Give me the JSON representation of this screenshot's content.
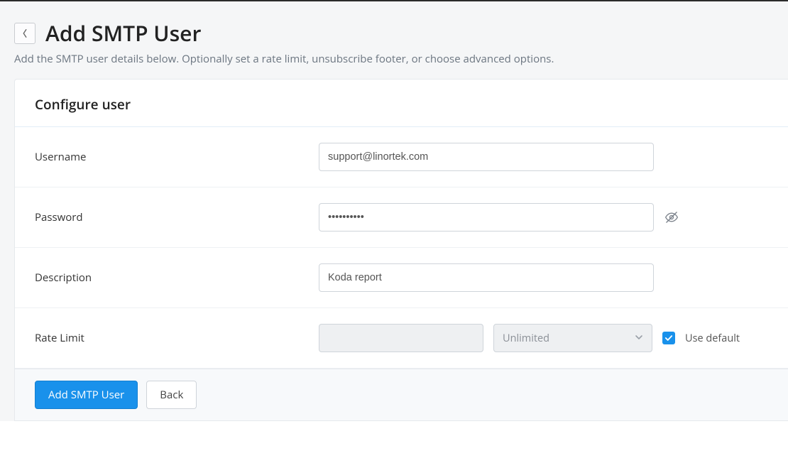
{
  "header": {
    "title": "Add SMTP User",
    "subtitle": "Add the SMTP user details below. Optionally set a rate limit, unsubscribe footer, or choose advanced options."
  },
  "panel": {
    "section_title": "Configure user",
    "fields": {
      "username": {
        "label": "Username",
        "value": "support@linortek.com"
      },
      "password": {
        "label": "Password",
        "value": "••••••••••"
      },
      "description": {
        "label": "Description",
        "value": "Koda report"
      },
      "rate_limit": {
        "label": "Rate Limit",
        "value": "",
        "unit_selected": "Unlimited",
        "use_default_label": "Use default",
        "use_default_checked": true
      }
    }
  },
  "footer": {
    "primary_label": "Add SMTP User",
    "secondary_label": "Back"
  }
}
